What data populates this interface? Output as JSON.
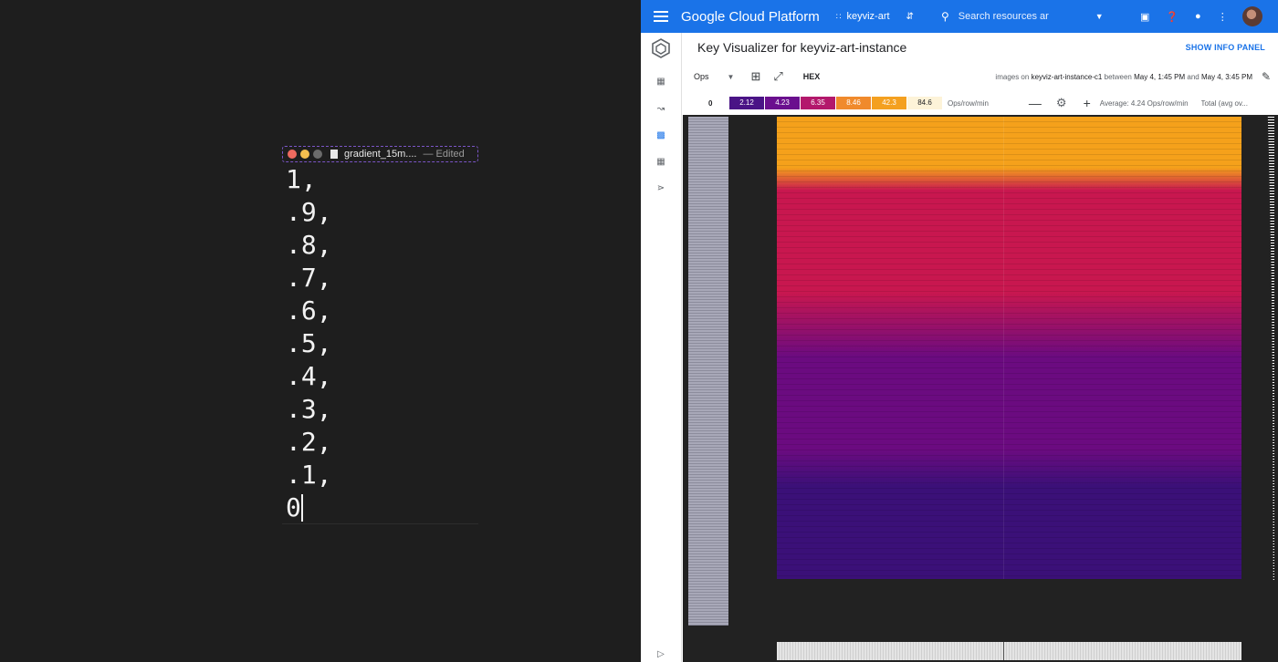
{
  "editor": {
    "filename": "gradient_15m....",
    "status": "— Edited",
    "lines": [
      "1,",
      ".9,",
      ".8,",
      ".7,",
      ".6,",
      ".5,",
      ".4,",
      ".3,",
      ".2,",
      ".1,",
      "0"
    ]
  },
  "gcp": {
    "app_title": "Google Cloud Platform",
    "project": "keyviz-art",
    "search_placeholder": "Search resources ar",
    "page_title": "Key Visualizer for keyviz-art-instance",
    "show_info_panel": "SHOW INFO PANEL",
    "toolbar": {
      "metric": "Ops",
      "hex_label": "HEX",
      "time_info_prefix": "images on",
      "time_info_instance": "keyviz-art-instance-c1",
      "time_info_between": "between",
      "time_info_start": "May 4, 1:45 PM",
      "time_info_and": "and",
      "time_info_end": "May 4, 3:45 PM"
    },
    "legend": {
      "zero": "0",
      "cells": [
        {
          "label": "2.12",
          "color": "#4a1486"
        },
        {
          "label": "4.23",
          "color": "#6a0f8e"
        },
        {
          "label": "6.35",
          "color": "#b3186c"
        },
        {
          "label": "8.46",
          "color": "#f08a2c"
        },
        {
          "label": "42.3",
          "color": "#f4a020"
        },
        {
          "label": "84.6",
          "color": "#fdf3d8"
        }
      ],
      "unit": "Ops/row/min",
      "average": "Average: 4.24 Ops/row/min",
      "total": "Total (avg ov..."
    },
    "colors": {
      "topbar": "#1a73e8",
      "heat_orange": "#f5a11b",
      "heat_red": "#c8174f",
      "heat_purple": "#6b0b80",
      "heat_indigo": "#3b1078"
    }
  }
}
